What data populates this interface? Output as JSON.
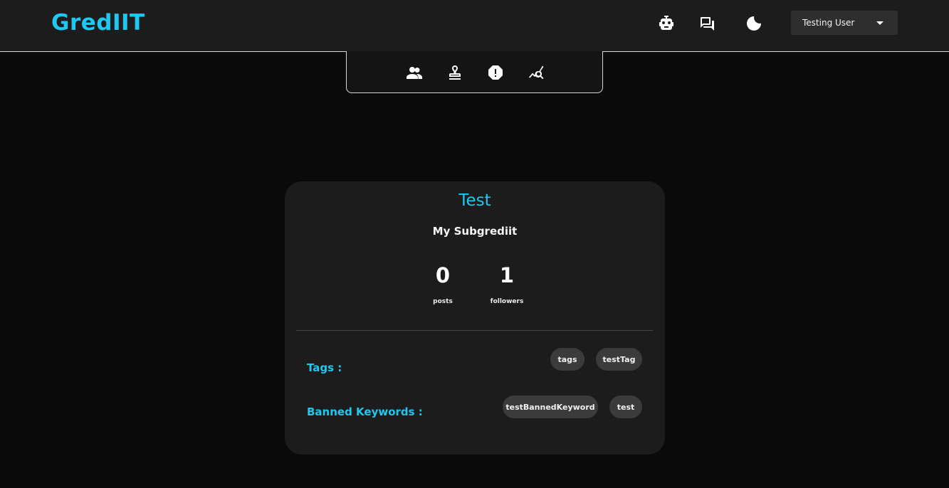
{
  "header": {
    "logo": "GredIIT",
    "icons": [
      "robot-icon",
      "chat-icon",
      "moon-icon"
    ],
    "user_select": {
      "value": "Testing User"
    }
  },
  "tabs": [
    "users-icon",
    "stamp-icon",
    "report-icon",
    "stats-search-icon"
  ],
  "subgreddiit": {
    "name": "Test",
    "description": "My Subgrediit",
    "stats": [
      {
        "value": "0",
        "label": "posts"
      },
      {
        "value": "1",
        "label": "followers"
      }
    ],
    "tags_label": "Tags :",
    "tags": [
      "tags",
      "testTag"
    ],
    "banned_label": "Banned Keywords :",
    "banned_keywords": [
      "testBannedKeyword",
      "test"
    ]
  },
  "colors": {
    "accent": "#1fc8f0",
    "background": "#0a0a0a",
    "surface": "#1c1c1c",
    "chip": "#3b3b3b"
  }
}
